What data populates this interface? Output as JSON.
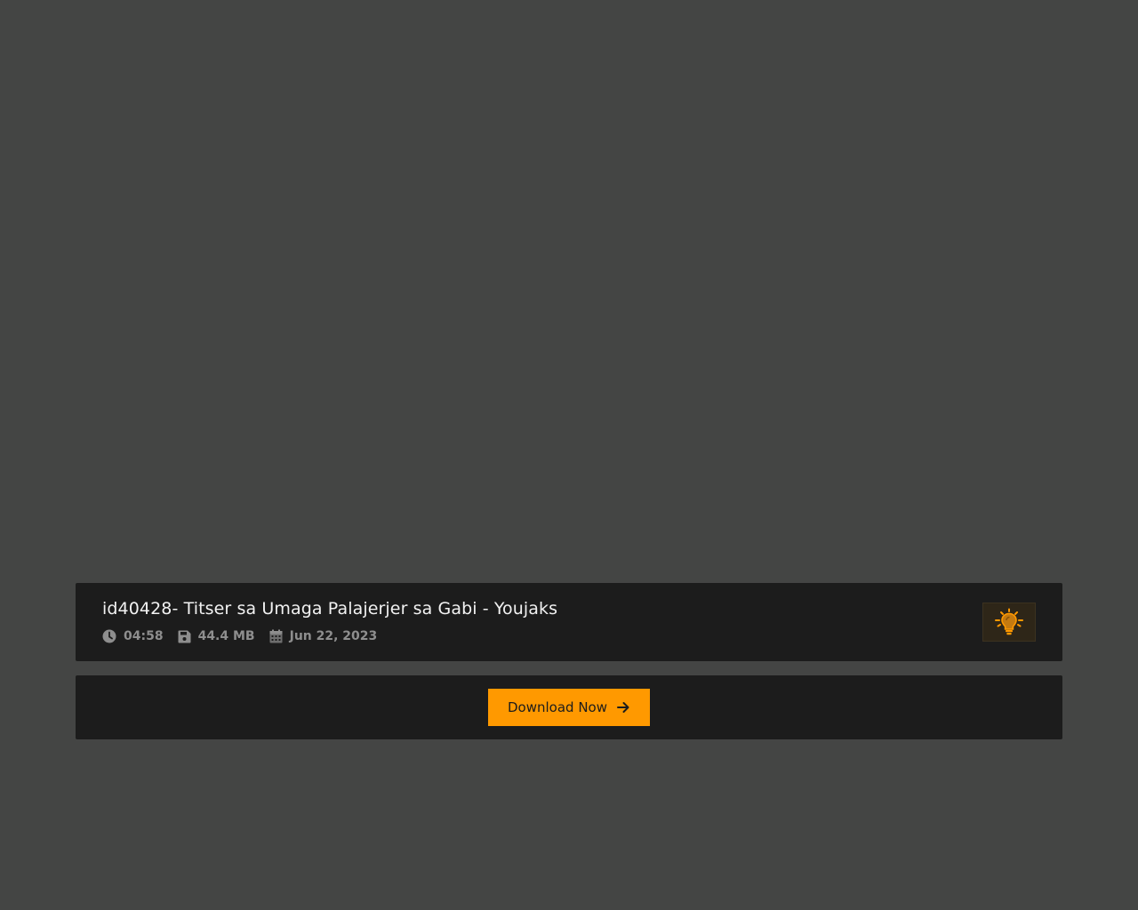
{
  "video": {
    "title": "id40428- Titser sa Umaga Palajerjer sa Gabi - Youjaks",
    "duration": "04:58",
    "size": "44.4 MB",
    "date": "Jun 22, 2023"
  },
  "actions": {
    "download_label": "Download Now",
    "download_icon": "arrow-right-icon",
    "lights_icon": "lightbulb-icon"
  },
  "colors": {
    "accent": "#ff9900",
    "panel": "#1c1c1c",
    "background": "#444544",
    "meta_text": "#8e8e8e"
  }
}
